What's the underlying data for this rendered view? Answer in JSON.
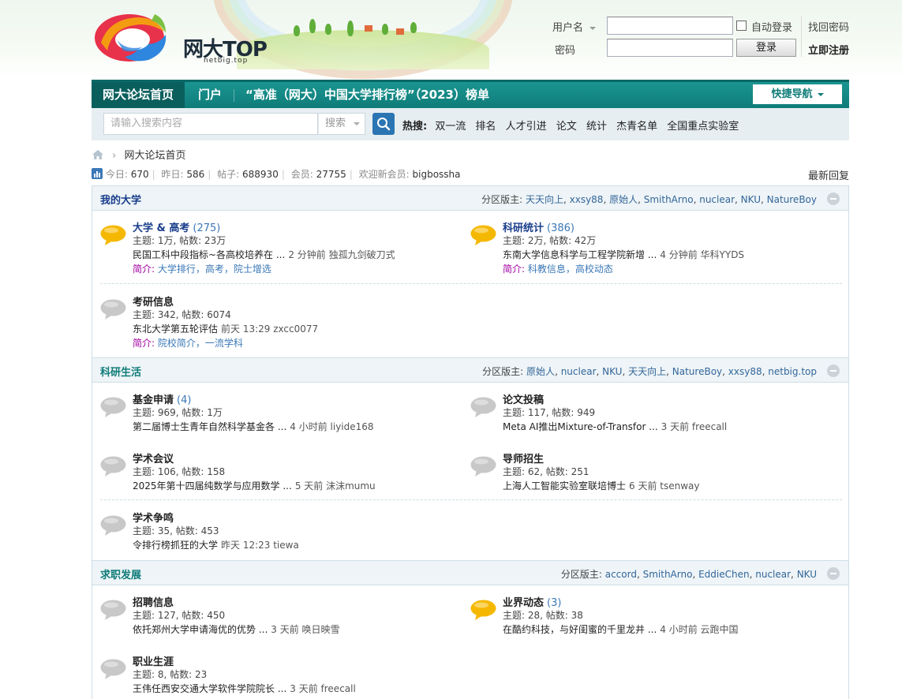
{
  "header": {
    "logo_text": "网大TOP",
    "logo_sub": "netbig.top",
    "username_label": "用户名",
    "password_label": "密码",
    "auto_login_label": "自动登录",
    "login_button": "登录",
    "find_password": "找回密码",
    "register": "立即注册"
  },
  "nav": {
    "items": [
      "网大论坛首页",
      "门户",
      "“高准（网大）中国大学排行榜”（2023）榜单"
    ],
    "quick_nav": "快捷导航"
  },
  "search": {
    "placeholder": "请输入搜索内容",
    "type": "搜索",
    "hot_label": "热搜:",
    "hot_items": [
      "双一流",
      "排名",
      "人才引进",
      "论文",
      "统计",
      "杰青名单",
      "全国重点实验室"
    ]
  },
  "breadcrumb": {
    "current": "网大论坛首页"
  },
  "stats": {
    "today_label": "今日:",
    "today": "670",
    "yesterday_label": "昨日:",
    "yesterday": "586",
    "posts_label": "帖子:",
    "posts": "688930",
    "members_label": "会员:",
    "members": "27755",
    "welcome_label": "欢迎新会员:",
    "new_member": "bigbossha",
    "latest_reply": "最新回复"
  },
  "sections": [
    {
      "title": "我的大学",
      "mods_label": "分区版主:",
      "mods": [
        "天天向上",
        "xxsy88",
        "原始人",
        "SmithArno",
        "nuclear",
        "NKU",
        "NatureBoy"
      ],
      "forums": [
        {
          "name": "大学 & 高考",
          "count": "(275)",
          "meta": "主题: 1万, 帖数: 23万",
          "last": "民国工科中段指标~各高校培养在 ...",
          "time": "2 分钟前 独孤九剑破刀式",
          "intro_label": "简介:",
          "intro": "大学排行，高考，院士增选"
        },
        {
          "name": "科研统计",
          "count": "(386)",
          "meta": "主题: 2万, 帖数: 42万",
          "last": "东南大学信息科学与工程学院新增 ...",
          "time": "4 分钟前 华科YYDS",
          "intro_label": "简介:",
          "intro": "科教信息，高校动态"
        },
        {
          "name": "考研信息",
          "count": "",
          "meta": "主题: 342, 帖数: 6074",
          "last": "东北大学第五轮评估",
          "time": "前天 13:29 zxcc0077",
          "intro_label": "简介:",
          "intro": "院校简介，一流学科"
        }
      ]
    },
    {
      "title": "科研生活",
      "mods_label": "分区版主:",
      "mods": [
        "原始人",
        "nuclear",
        "NKU",
        "天天向上",
        "NatureBoy",
        "xxsy88",
        "netbig.top"
      ],
      "forums": [
        {
          "name": "基金申请",
          "count": "(4)",
          "meta": "主题: 969, 帖数: 1万",
          "last": "第二届博士生青年自然科学基金各 ...",
          "time": "4 小时前 liyide168"
        },
        {
          "name": "论文投稿",
          "count": "",
          "meta": "主题: 117, 帖数: 949",
          "last": "Meta AI推出Mixture-of-Transfor ...",
          "time": "3 天前 freecall"
        },
        {
          "name": "学术会议",
          "count": "",
          "meta": "主题: 106, 帖数: 158",
          "last": "2025年第十四届纯数学与应用数学 ...",
          "time": "5 天前 沫沫mumu"
        },
        {
          "name": "导师招生",
          "count": "",
          "meta": "主题: 62, 帖数: 251",
          "last": "上海人工智能实验室联培博士",
          "time": "6 天前 tsenway"
        },
        {
          "name": "学术争鸣",
          "count": "",
          "meta": "主题: 35, 帖数: 453",
          "last": "令排行榜抓狂的大学",
          "time": "昨天 12:23 tiewa"
        }
      ]
    },
    {
      "title": "求职发展",
      "mods_label": "分区版主:",
      "mods": [
        "accord",
        "SmithArno",
        "EddieChen",
        "nuclear",
        "NKU"
      ],
      "forums": [
        {
          "name": "招聘信息",
          "count": "",
          "meta": "主题: 127, 帖数: 450",
          "last": "依托郑州大学申请海优的优势 ...",
          "time": "3 天前 唤日映雪"
        },
        {
          "name": "业界动态",
          "count": "(3)",
          "meta": "主题: 28, 帖数: 38",
          "last": "在酷约科技，与好闺蜜的千里龙井 ...",
          "time": "4 小时前 云跑中国"
        },
        {
          "name": "职业生涯",
          "count": "",
          "meta": "主题: 8, 帖数: 23",
          "last": "王伟任西安交通大学软件学院院长 ...",
          "time": "3 天前 freecall"
        }
      ]
    }
  ],
  "colors": {
    "nav_teal": "#0f7c79",
    "new_bubble": "#f5b800",
    "old_bubble": "#c8c8c8",
    "link_blue": "#3b78b7"
  }
}
